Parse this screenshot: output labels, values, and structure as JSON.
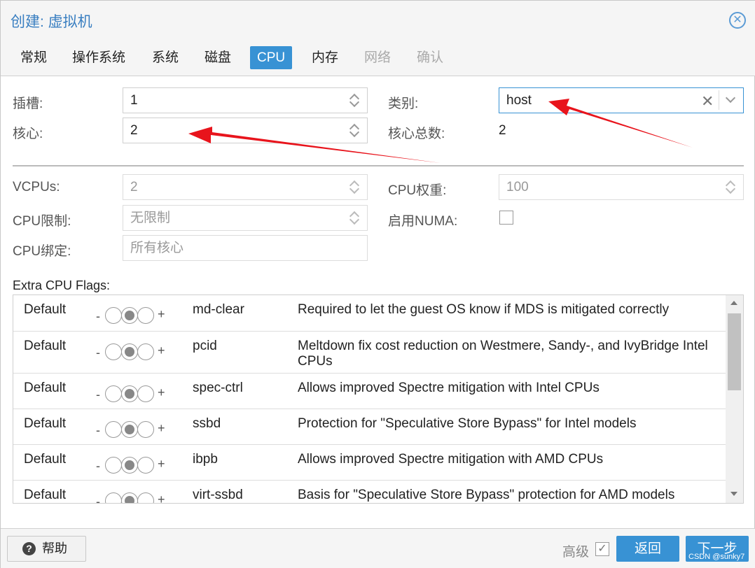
{
  "window": {
    "title": "创建: 虚拟机",
    "close_icon": "close-icon"
  },
  "tabs": [
    {
      "label": "常规",
      "state": "normal"
    },
    {
      "label": "操作系统",
      "state": "normal"
    },
    {
      "label": "系统",
      "state": "normal"
    },
    {
      "label": "磁盘",
      "state": "normal"
    },
    {
      "label": "CPU",
      "state": "active"
    },
    {
      "label": "内存",
      "state": "normal"
    },
    {
      "label": "网络",
      "state": "disabled"
    },
    {
      "label": "确认",
      "state": "disabled"
    }
  ],
  "cpu": {
    "sockets_label": "插槽:",
    "sockets_value": "1",
    "cores_label": "核心:",
    "cores_value": "2",
    "type_label": "类别:",
    "type_value": "host",
    "total_cores_label": "核心总数:",
    "total_cores_value": "2"
  },
  "advanced": {
    "vcpus_label": "VCPUs:",
    "vcpus_value": "2",
    "weight_label": "CPU权重:",
    "weight_placeholder": "100",
    "limit_label": "CPU限制:",
    "limit_placeholder": "无限制",
    "numa_label": "启用NUMA:",
    "numa_checked": false,
    "affinity_label": "CPU绑定:",
    "affinity_placeholder": "所有核心"
  },
  "flags": {
    "title": "Extra CPU Flags:",
    "minus": "-",
    "plus": "+",
    "rows": [
      {
        "state": "Default",
        "name": "md-clear",
        "description": "Required to let the guest OS know if MDS is mitigated correctly"
      },
      {
        "state": "Default",
        "name": "pcid",
        "description": "Meltdown fix cost reduction on Westmere, Sandy-, and IvyBridge Intel CPUs"
      },
      {
        "state": "Default",
        "name": "spec-ctrl",
        "description": "Allows improved Spectre mitigation with Intel CPUs"
      },
      {
        "state": "Default",
        "name": "ssbd",
        "description": "Protection for \"Speculative Store Bypass\" for Intel models"
      },
      {
        "state": "Default",
        "name": "ibpb",
        "description": "Allows improved Spectre mitigation with AMD CPUs"
      },
      {
        "state": "Default",
        "name": "virt-ssbd",
        "description": "Basis for \"Speculative Store Bypass\" protection for AMD models"
      }
    ]
  },
  "footer": {
    "help_label": "帮助",
    "help_icon": "question-circle-icon",
    "advanced_label": "高级",
    "advanced_checked": true,
    "back_label": "返回",
    "next_label": "下一步"
  },
  "watermark": "CSDN @sunky7",
  "colors": {
    "accent": "#3892d4",
    "title": "#3a7fc1",
    "annotation_arrow": "#e8141c"
  }
}
